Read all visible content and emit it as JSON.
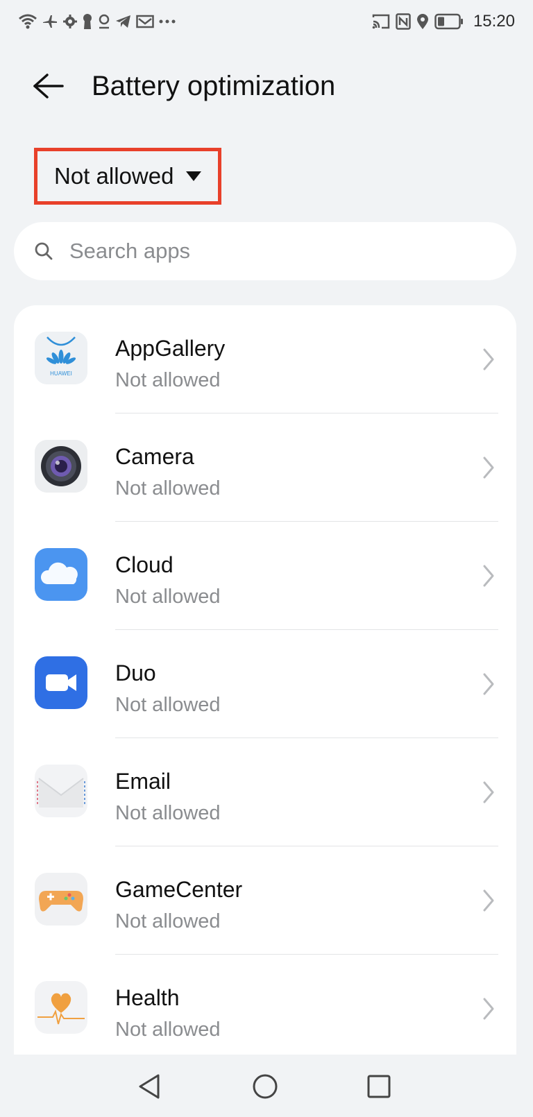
{
  "status_bar": {
    "time": "15:20",
    "left_icons": [
      "wifi-icon",
      "airplane-icon",
      "settings-gear-icon",
      "keyhole-icon",
      "location-pin-icon",
      "telegram-icon",
      "mail-icon",
      "more-dots-icon"
    ],
    "right_icons": [
      "cast-icon",
      "nfc-icon",
      "location-icon",
      "battery-icon"
    ]
  },
  "header": {
    "title": "Battery optimization",
    "back_icon": "back-arrow-icon"
  },
  "filter": {
    "label": "Not allowed",
    "highlight_color": "#e8402a"
  },
  "search": {
    "placeholder": "Search apps",
    "value": ""
  },
  "apps": [
    {
      "name": "AppGallery",
      "status": "Not allowed",
      "icon": "appgallery-icon"
    },
    {
      "name": "Camera",
      "status": "Not allowed",
      "icon": "camera-icon"
    },
    {
      "name": "Cloud",
      "status": "Not allowed",
      "icon": "cloud-icon"
    },
    {
      "name": "Duo",
      "status": "Not allowed",
      "icon": "duo-icon"
    },
    {
      "name": "Email",
      "status": "Not allowed",
      "icon": "email-icon"
    },
    {
      "name": "GameCenter",
      "status": "Not allowed",
      "icon": "gamecenter-icon"
    },
    {
      "name": "Health",
      "status": "Not allowed",
      "icon": "health-icon"
    }
  ],
  "nav_bar": {
    "buttons": [
      "back-triangle-icon",
      "home-circle-icon",
      "recents-square-icon"
    ]
  }
}
